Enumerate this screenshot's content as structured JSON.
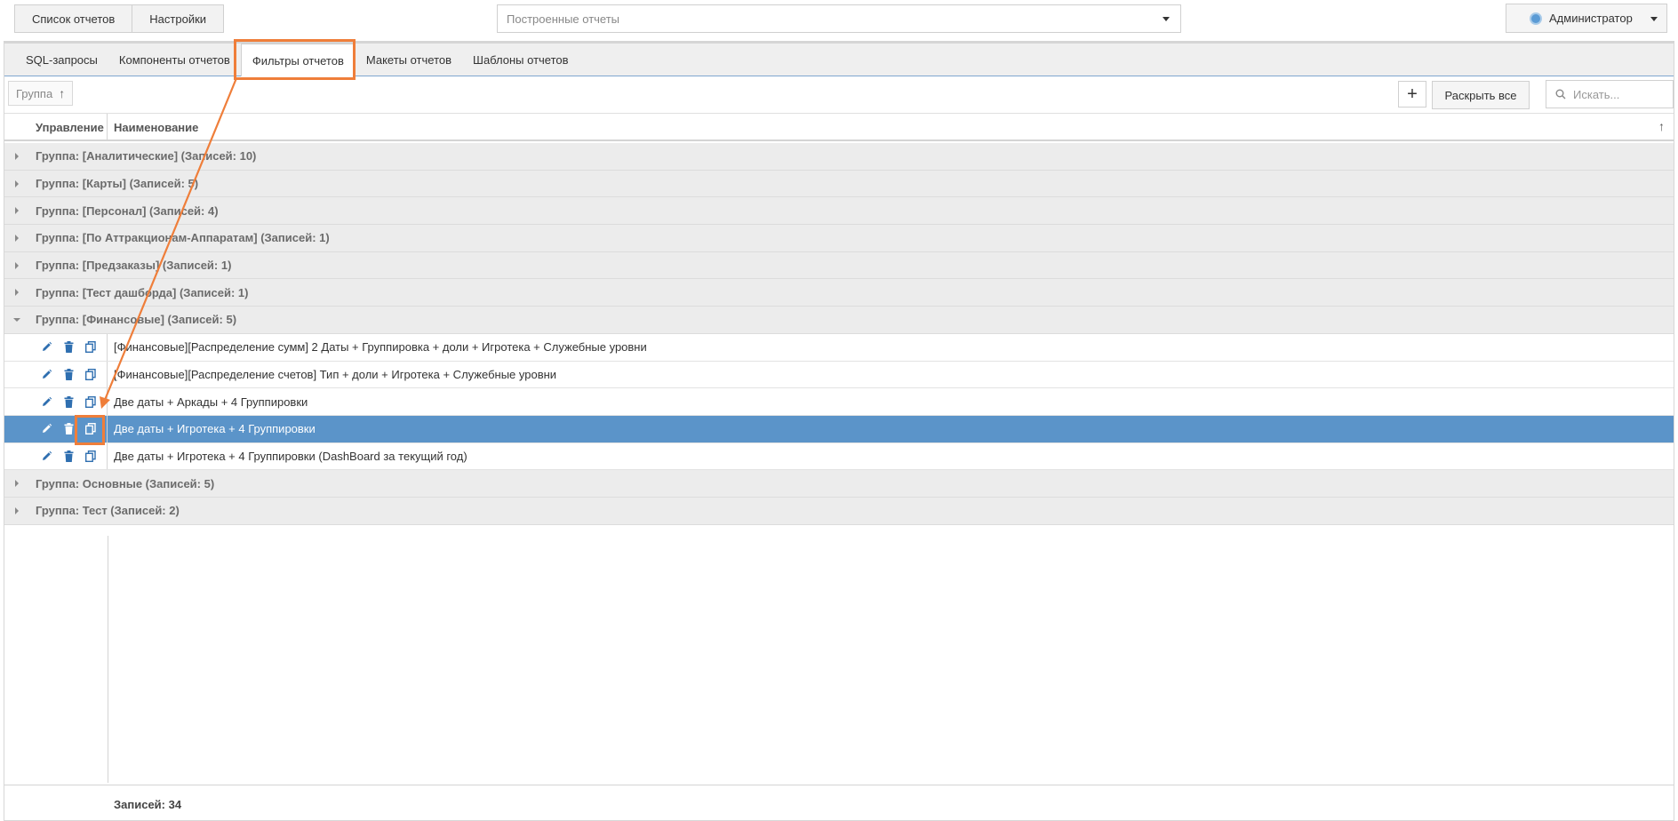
{
  "topbar": {
    "reports_list": "Список отчетов",
    "settings": "Настройки",
    "report_select_placeholder": "Построенные отчеты",
    "user": "Администратор"
  },
  "tabs": [
    {
      "label": "SQL-запросы"
    },
    {
      "label": "Компоненты отчетов"
    },
    {
      "label": "Фильтры отчетов"
    },
    {
      "label": "Макеты отчетов"
    },
    {
      "label": "Шаблоны отчетов"
    }
  ],
  "active_tab": "Фильтры отчетов",
  "toolbar": {
    "group_chip": "Группа",
    "add_label": "+",
    "expand_all": "Раскрыть все",
    "search_placeholder": "Искать..."
  },
  "grid": {
    "col_control": "Управление",
    "col_name": "Наименование",
    "groups_before": [
      {
        "label": "Группа: [Аналитические] (Записей: 10)"
      },
      {
        "label": "Группа: [Карты] (Записей: 5)"
      },
      {
        "label": "Группа: [Персонал] (Записей: 4)"
      },
      {
        "label": "Группа: [По Аттракционам-Аппаратам] (Записей: 1)"
      },
      {
        "label": "Группа: [Предзаказы] (Записей: 1)"
      },
      {
        "label": "Группа: [Тест дашборда] (Записей: 1)"
      }
    ],
    "open_group": {
      "label": "Группа: [Финансовые] (Записей: 5)"
    },
    "rows": [
      {
        "name": "[Финансовые][Распределение сумм] 2 Даты + Группировка + доли + Игротека + Служебные уровни"
      },
      {
        "name": "[Финансовые][Распределение счетов] Тип + доли + Игротека + Служебные уровни"
      },
      {
        "name": "Две даты + Аркады + 4 Группировки"
      },
      {
        "name": "Две даты + Игротека + 4 Группировки"
      },
      {
        "name": "Две даты + Игротека + 4 Группировки (DashBoard за текущий год)"
      }
    ],
    "selected_row_index": 3,
    "groups_after": [
      {
        "label": "Группа: Основные (Записей: 5)"
      },
      {
        "label": "Группа: Тест (Записей: 2)"
      }
    ],
    "footer_count": "Записей: 34"
  },
  "colors": {
    "accent": "#ef7e3a",
    "selection": "#5b94c9",
    "icon_blue": "#2f6fb0"
  }
}
